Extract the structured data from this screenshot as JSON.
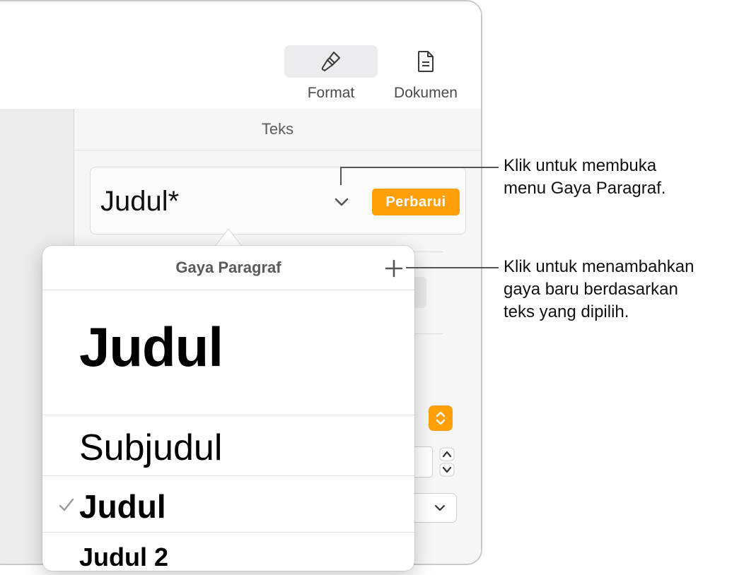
{
  "toolbar": {
    "format_label": "Format",
    "document_label": "Dokumen"
  },
  "sidebar": {
    "section_tab": "Teks",
    "current_style": "Judul*",
    "update_button": "Perbarui"
  },
  "popover": {
    "title": "Gaya Paragraf",
    "items": [
      {
        "label": "Judul",
        "checked": false
      },
      {
        "label": "Subjudul",
        "checked": false
      },
      {
        "label": "Judul",
        "checked": true
      },
      {
        "label": "Judul 2",
        "checked": false
      }
    ]
  },
  "callouts": {
    "menu_line1": "Klik untuk membuka",
    "menu_line2": "menu Gaya Paragraf.",
    "add_line1": "Klik untuk menambahkan",
    "add_line2": "gaya baru berdasarkan",
    "add_line3": "teks yang dipilih."
  },
  "colors": {
    "accent": "#ff9f0a"
  }
}
